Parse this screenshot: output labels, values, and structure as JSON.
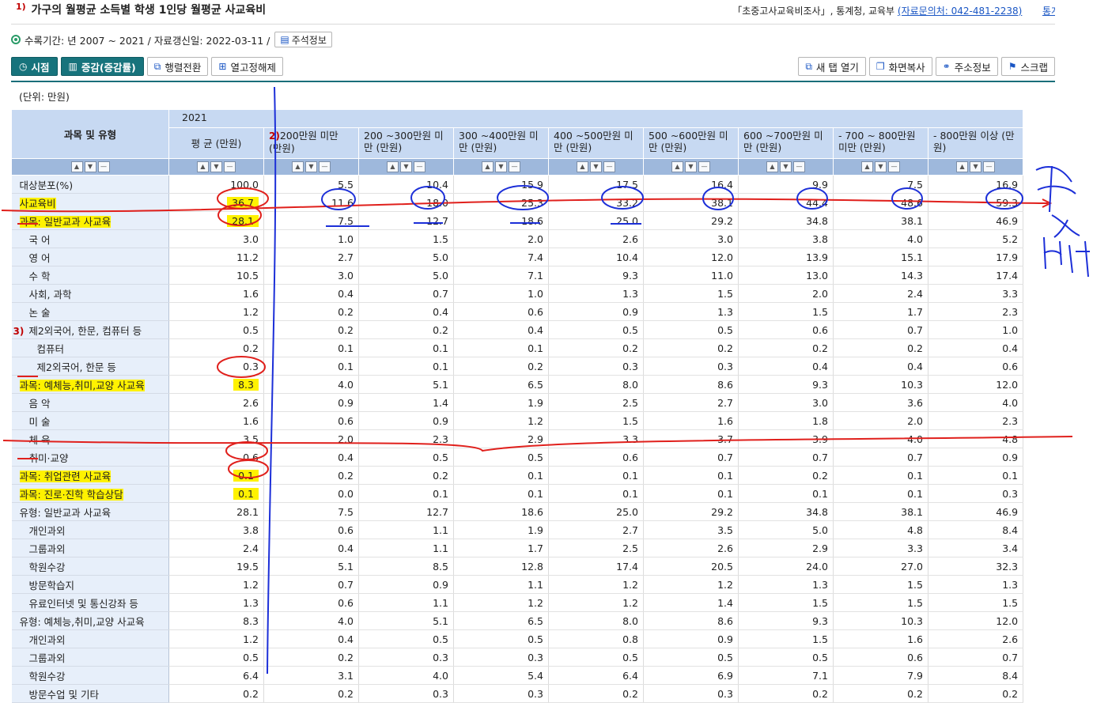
{
  "header": {
    "footnote_mark": "1)",
    "title": "가구의 월평균 소득별 학생 1인당 월평균 사교육비",
    "source_text": "「초중고사교육비조사」, 통계청, 교육부",
    "contact_link": "(자료문의처: 042-481-2238)",
    "cut_link": "통계"
  },
  "meta": {
    "period_text": "수록기간: 년 2007 ~ 2021 / 자료갱신일: 2022-03-11 /",
    "notes_button": "주석정보"
  },
  "toolbar": {
    "time_button": "시점",
    "change_button": "증감(증감률)",
    "transpose_button": "행렬전환",
    "unfix_button": "열고정해제",
    "new_tab_button": "새 탭 열기",
    "screen_copy_button": "화면복사",
    "address_button": "주소정보",
    "scrap_button": "스크랩"
  },
  "unit_label": "(단위: 만원)",
  "table": {
    "corner_label": "과목 및 유형",
    "year": "2021",
    "col_headers": [
      "평 균 (만원)",
      "200만원 미만 (만원)",
      "200 ~300만원 미만 (만원)",
      "300 ~400만원 미만 (만원)",
      "400 ~500만원 미만 (만원)",
      "500 ~600만원 미만 (만원)",
      "600 ~700만원 미만 (만원)",
      "- 700 ~ 800만원 미만 (만원)",
      "- 800만원 이상 (만원)"
    ],
    "col2_note": "2)",
    "rows": [
      {
        "label": "대상분포(%)",
        "values": [
          "100.0",
          "5.5",
          "10.4",
          "15.9",
          "17.5",
          "16.4",
          "9.9",
          "7.5",
          "16.9"
        ]
      },
      {
        "label": "사교육비",
        "values": [
          "36.7",
          "11.6",
          "18.0",
          "25.3",
          "33.2",
          "38.1",
          "44.4",
          "48.6",
          "59.3"
        ]
      },
      {
        "label": "과목: 일반교과 사교육",
        "values": [
          "28.1",
          "7.5",
          "12.7",
          "18.6",
          "25.0",
          "29.2",
          "34.8",
          "38.1",
          "46.9"
        ]
      },
      {
        "label": "국 어",
        "values": [
          "3.0",
          "1.0",
          "1.5",
          "2.0",
          "2.6",
          "3.0",
          "3.8",
          "4.0",
          "5.2"
        ]
      },
      {
        "label": "영 어",
        "values": [
          "11.2",
          "2.7",
          "5.0",
          "7.4",
          "10.4",
          "12.0",
          "13.9",
          "15.1",
          "17.9"
        ]
      },
      {
        "label": "수 학",
        "values": [
          "10.5",
          "3.0",
          "5.0",
          "7.1",
          "9.3",
          "11.0",
          "13.0",
          "14.3",
          "17.4"
        ]
      },
      {
        "label": "사회, 과학",
        "values": [
          "1.6",
          "0.4",
          "0.7",
          "1.0",
          "1.3",
          "1.5",
          "2.0",
          "2.4",
          "3.3"
        ]
      },
      {
        "label": "논 술",
        "values": [
          "1.2",
          "0.2",
          "0.4",
          "0.6",
          "0.9",
          "1.3",
          "1.5",
          "1.7",
          "2.3"
        ]
      },
      {
        "label": "제2외국어, 한문, 컴퓨터 등",
        "note": "3)",
        "values": [
          "0.5",
          "0.2",
          "0.2",
          "0.4",
          "0.5",
          "0.5",
          "0.6",
          "0.7",
          "1.0"
        ]
      },
      {
        "label": "컴퓨터",
        "values": [
          "0.2",
          "0.1",
          "0.1",
          "0.1",
          "0.2",
          "0.2",
          "0.2",
          "0.2",
          "0.4"
        ]
      },
      {
        "label": "제2외국어, 한문 등",
        "values": [
          "0.3",
          "0.1",
          "0.1",
          "0.2",
          "0.3",
          "0.3",
          "0.4",
          "0.4",
          "0.6"
        ]
      },
      {
        "label": "과목: 예체능,취미,교양 사교육",
        "values": [
          "8.3",
          "4.0",
          "5.1",
          "6.5",
          "8.0",
          "8.6",
          "9.3",
          "10.3",
          "12.0"
        ]
      },
      {
        "label": "음 악",
        "values": [
          "2.6",
          "0.9",
          "1.4",
          "1.9",
          "2.5",
          "2.7",
          "3.0",
          "3.6",
          "4.0"
        ]
      },
      {
        "label": "미 술",
        "values": [
          "1.6",
          "0.6",
          "0.9",
          "1.2",
          "1.5",
          "1.6",
          "1.8",
          "2.0",
          "2.3"
        ]
      },
      {
        "label": "체 육",
        "values": [
          "3.5",
          "2.0",
          "2.3",
          "2.9",
          "3.3",
          "3.7",
          "3.9",
          "4.0",
          "4.8"
        ]
      },
      {
        "label": "취미·교양",
        "values": [
          "0.6",
          "0.4",
          "0.5",
          "0.5",
          "0.6",
          "0.7",
          "0.7",
          "0.7",
          "0.9"
        ]
      },
      {
        "label": "과목: 취업관련 사교육",
        "values": [
          "0.1",
          "0.2",
          "0.2",
          "0.1",
          "0.1",
          "0.1",
          "0.2",
          "0.1",
          "0.1"
        ]
      },
      {
        "label": "과목: 진로·진학 학습상담",
        "values": [
          "0.1",
          "0.0",
          "0.1",
          "0.1",
          "0.1",
          "0.1",
          "0.1",
          "0.1",
          "0.3"
        ]
      },
      {
        "label": "유형: 일반교과 사교육",
        "values": [
          "28.1",
          "7.5",
          "12.7",
          "18.6",
          "25.0",
          "29.2",
          "34.8",
          "38.1",
          "46.9"
        ]
      },
      {
        "label": "개인과외",
        "values": [
          "3.8",
          "0.6",
          "1.1",
          "1.9",
          "2.7",
          "3.5",
          "5.0",
          "4.8",
          "8.4"
        ]
      },
      {
        "label": "그룹과외",
        "values": [
          "2.4",
          "0.4",
          "1.1",
          "1.7",
          "2.5",
          "2.6",
          "2.9",
          "3.3",
          "3.4"
        ]
      },
      {
        "label": "학원수강",
        "values": [
          "19.5",
          "5.1",
          "8.5",
          "12.8",
          "17.4",
          "20.5",
          "24.0",
          "27.0",
          "32.3"
        ]
      },
      {
        "label": "방문학습지",
        "values": [
          "1.2",
          "0.7",
          "0.9",
          "1.1",
          "1.2",
          "1.2",
          "1.3",
          "1.5",
          "1.3"
        ]
      },
      {
        "label": "유료인터넷 및 통신강좌 등",
        "values": [
          "1.3",
          "0.6",
          "1.1",
          "1.2",
          "1.2",
          "1.4",
          "1.5",
          "1.5",
          "1.5"
        ]
      },
      {
        "label": "유형: 예체능,취미,교양 사교육",
        "values": [
          "8.3",
          "4.0",
          "5.1",
          "6.5",
          "8.0",
          "8.6",
          "9.3",
          "10.3",
          "12.0"
        ]
      },
      {
        "label": "개인과외",
        "values": [
          "1.2",
          "0.4",
          "0.5",
          "0.5",
          "0.8",
          "0.9",
          "1.5",
          "1.6",
          "2.6"
        ]
      },
      {
        "label": "그룹과외",
        "values": [
          "0.5",
          "0.2",
          "0.3",
          "0.3",
          "0.5",
          "0.5",
          "0.5",
          "0.6",
          "0.7"
        ]
      },
      {
        "label": "학원수강",
        "values": [
          "6.4",
          "3.1",
          "4.0",
          "5.4",
          "6.4",
          "6.9",
          "7.1",
          "7.9",
          "8.4"
        ]
      },
      {
        "label": "방문수업 및 기타",
        "values": [
          "0.2",
          "0.2",
          "0.3",
          "0.3",
          "0.2",
          "0.3",
          "0.2",
          "0.2",
          "0.2"
        ]
      }
    ]
  },
  "colors": {
    "teal": "#17737c",
    "header_blue": "#c7d9f2",
    "sort_blue": "#9eb8dc",
    "highlight": "#fff200",
    "pen_red": "#e0201c",
    "pen_blue": "#1c2fd8"
  }
}
